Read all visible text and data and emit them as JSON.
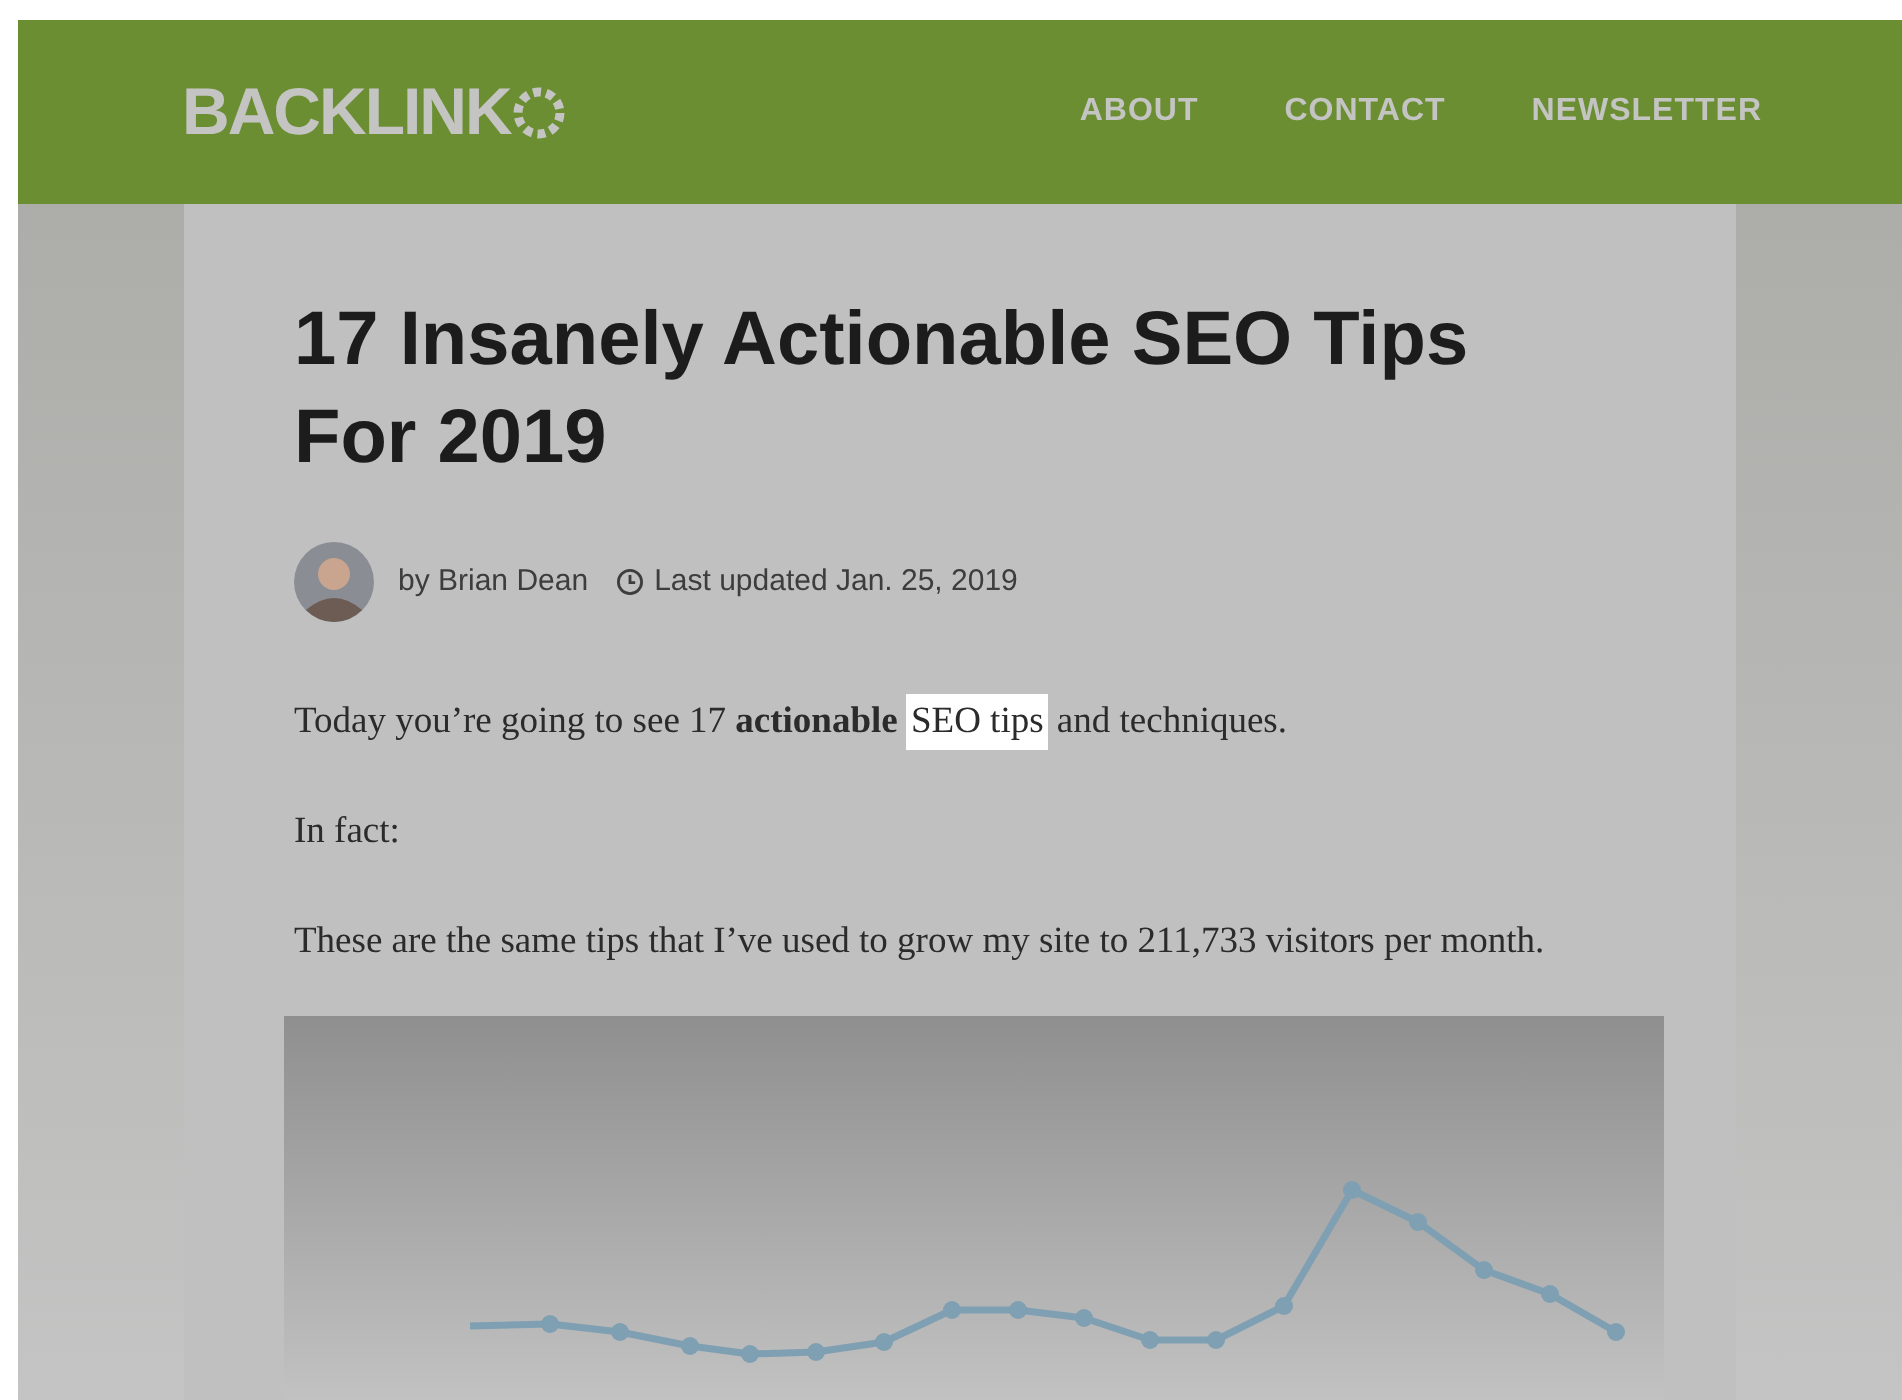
{
  "header": {
    "logo": "BACKLINK",
    "nav": [
      {
        "label": "ABOUT"
      },
      {
        "label": "CONTACT"
      },
      {
        "label": "NEWSLETTER"
      }
    ]
  },
  "article": {
    "title": "17 Insanely Actionable SEO Tips For 2019",
    "byline": {
      "author": "by Brian Dean",
      "updated": "Last updated Jan. 25, 2019"
    },
    "paragraphs": [
      {
        "segments": [
          {
            "text": "Today you’re going to see 17 **actionable** ",
            "highlighted": false
          },
          {
            "text": "SEO tips",
            "highlighted": true
          },
          {
            "text": " and techniques.",
            "highlighted": false
          }
        ]
      },
      {
        "segments": [
          {
            "text": "In fact:",
            "highlighted": false
          }
        ]
      },
      {
        "segments": [
          {
            "text": "These are the same tips that I’ve used to grow my site to 211,733 visitors per month.",
            "highlighted": false
          }
        ]
      }
    ]
  }
}
